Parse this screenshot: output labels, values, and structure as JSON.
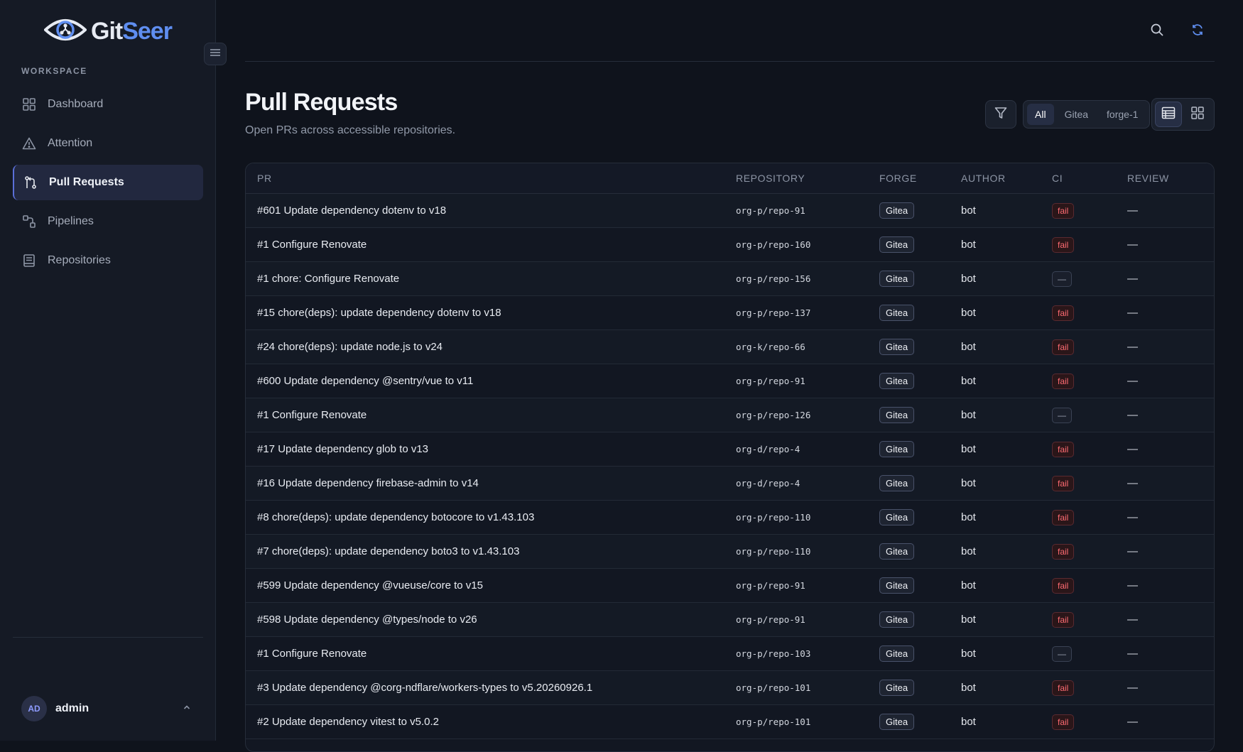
{
  "app": {
    "name_part1": "Git",
    "name_part2": "Seer"
  },
  "sidebar": {
    "section_label": "WORKSPACE",
    "items": [
      {
        "label": "Dashboard",
        "icon": "dashboard-grid-icon"
      },
      {
        "label": "Attention",
        "icon": "warning-triangle-icon"
      },
      {
        "label": "Pull Requests",
        "icon": "pull-request-icon",
        "active": true
      },
      {
        "label": "Pipelines",
        "icon": "pipeline-icon"
      },
      {
        "label": "Repositories",
        "icon": "book-icon"
      }
    ],
    "user": {
      "initials": "AD",
      "name": "admin"
    }
  },
  "header": {
    "title": "Pull Requests",
    "subtitle": "Open PRs across accessible repositories.",
    "forge_filter": {
      "options": [
        "All",
        "Gitea",
        "forge-1"
      ],
      "selected": "All"
    },
    "view_mode": "table"
  },
  "colors": {
    "accent": "#5f8ef0",
    "ci_fail": "#ff6b72",
    "background": "#0f131c",
    "sidebar": "#151a25"
  },
  "table": {
    "columns": [
      "PR",
      "REPOSITORY",
      "FORGE",
      "AUTHOR",
      "CI",
      "REVIEW"
    ],
    "rows": [
      {
        "pr": "#601 Update dependency dotenv to v18",
        "repo": "org-p/repo-91",
        "forge": "Gitea",
        "author": "bot",
        "ci": "fail",
        "review": "—"
      },
      {
        "pr": "#1 Configure Renovate",
        "repo": "org-p/repo-160",
        "forge": "Gitea",
        "author": "bot",
        "ci": "fail",
        "review": "—"
      },
      {
        "pr": "#1 chore: Configure Renovate",
        "repo": "org-p/repo-156",
        "forge": "Gitea",
        "author": "bot",
        "ci": "—",
        "review": "—"
      },
      {
        "pr": "#15 chore(deps): update dependency dotenv to v18",
        "repo": "org-p/repo-137",
        "forge": "Gitea",
        "author": "bot",
        "ci": "fail",
        "review": "—"
      },
      {
        "pr": "#24 chore(deps): update node.js to v24",
        "repo": "org-k/repo-66",
        "forge": "Gitea",
        "author": "bot",
        "ci": "fail",
        "review": "—"
      },
      {
        "pr": "#600 Update dependency @sentry/vue to v11",
        "repo": "org-p/repo-91",
        "forge": "Gitea",
        "author": "bot",
        "ci": "fail",
        "review": "—"
      },
      {
        "pr": "#1 Configure Renovate",
        "repo": "org-p/repo-126",
        "forge": "Gitea",
        "author": "bot",
        "ci": "—",
        "review": "—"
      },
      {
        "pr": "#17 Update dependency glob to v13",
        "repo": "org-d/repo-4",
        "forge": "Gitea",
        "author": "bot",
        "ci": "fail",
        "review": "—"
      },
      {
        "pr": "#16 Update dependency firebase-admin to v14",
        "repo": "org-d/repo-4",
        "forge": "Gitea",
        "author": "bot",
        "ci": "fail",
        "review": "—"
      },
      {
        "pr": "#8 chore(deps): update dependency botocore to v1.43.103",
        "repo": "org-p/repo-110",
        "forge": "Gitea",
        "author": "bot",
        "ci": "fail",
        "review": "—"
      },
      {
        "pr": "#7 chore(deps): update dependency boto3 to v1.43.103",
        "repo": "org-p/repo-110",
        "forge": "Gitea",
        "author": "bot",
        "ci": "fail",
        "review": "—"
      },
      {
        "pr": "#599 Update dependency @vueuse/core to v15",
        "repo": "org-p/repo-91",
        "forge": "Gitea",
        "author": "bot",
        "ci": "fail",
        "review": "—"
      },
      {
        "pr": "#598 Update dependency @types/node to v26",
        "repo": "org-p/repo-91",
        "forge": "Gitea",
        "author": "bot",
        "ci": "fail",
        "review": "—"
      },
      {
        "pr": "#1 Configure Renovate",
        "repo": "org-p/repo-103",
        "forge": "Gitea",
        "author": "bot",
        "ci": "—",
        "review": "—"
      },
      {
        "pr": "#3 Update dependency @corg-ndflare/workers-types to v5.20260926.1",
        "repo": "org-p/repo-101",
        "forge": "Gitea",
        "author": "bot",
        "ci": "fail",
        "review": "—"
      },
      {
        "pr": "#2 Update dependency vitest to v5.0.2",
        "repo": "org-p/repo-101",
        "forge": "Gitea",
        "author": "bot",
        "ci": "fail",
        "review": "—"
      }
    ]
  }
}
